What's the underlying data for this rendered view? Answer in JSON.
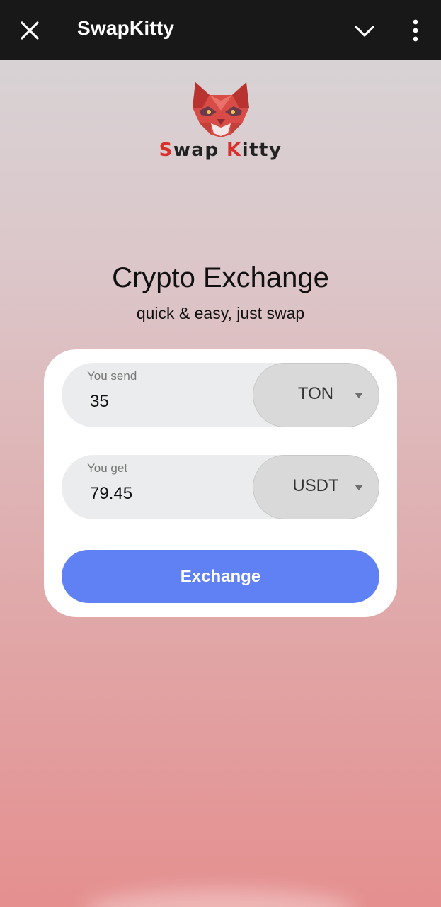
{
  "app": {
    "title": "SwapKitty"
  },
  "brand": {
    "first_initial": "S",
    "first_rest": "wap ",
    "second_initial": "K",
    "second_rest": "itty"
  },
  "hero": {
    "title": "Crypto Exchange",
    "subtitle": "quick & easy, just swap"
  },
  "form": {
    "send": {
      "label": "You send",
      "value": "35",
      "currency": "TON"
    },
    "get": {
      "label": "You get",
      "value": "79.45",
      "currency": "USDT"
    },
    "submit_label": "Exchange"
  },
  "colors": {
    "accent": "#5f81f3",
    "brand_red": "#d9302c",
    "topbar": "#181818"
  },
  "icons": {
    "close": "close-icon",
    "collapse": "chevron-down-icon",
    "menu": "more-vertical-icon",
    "logo": "cat-head-logo",
    "dropdown": "caret-down-icon"
  }
}
